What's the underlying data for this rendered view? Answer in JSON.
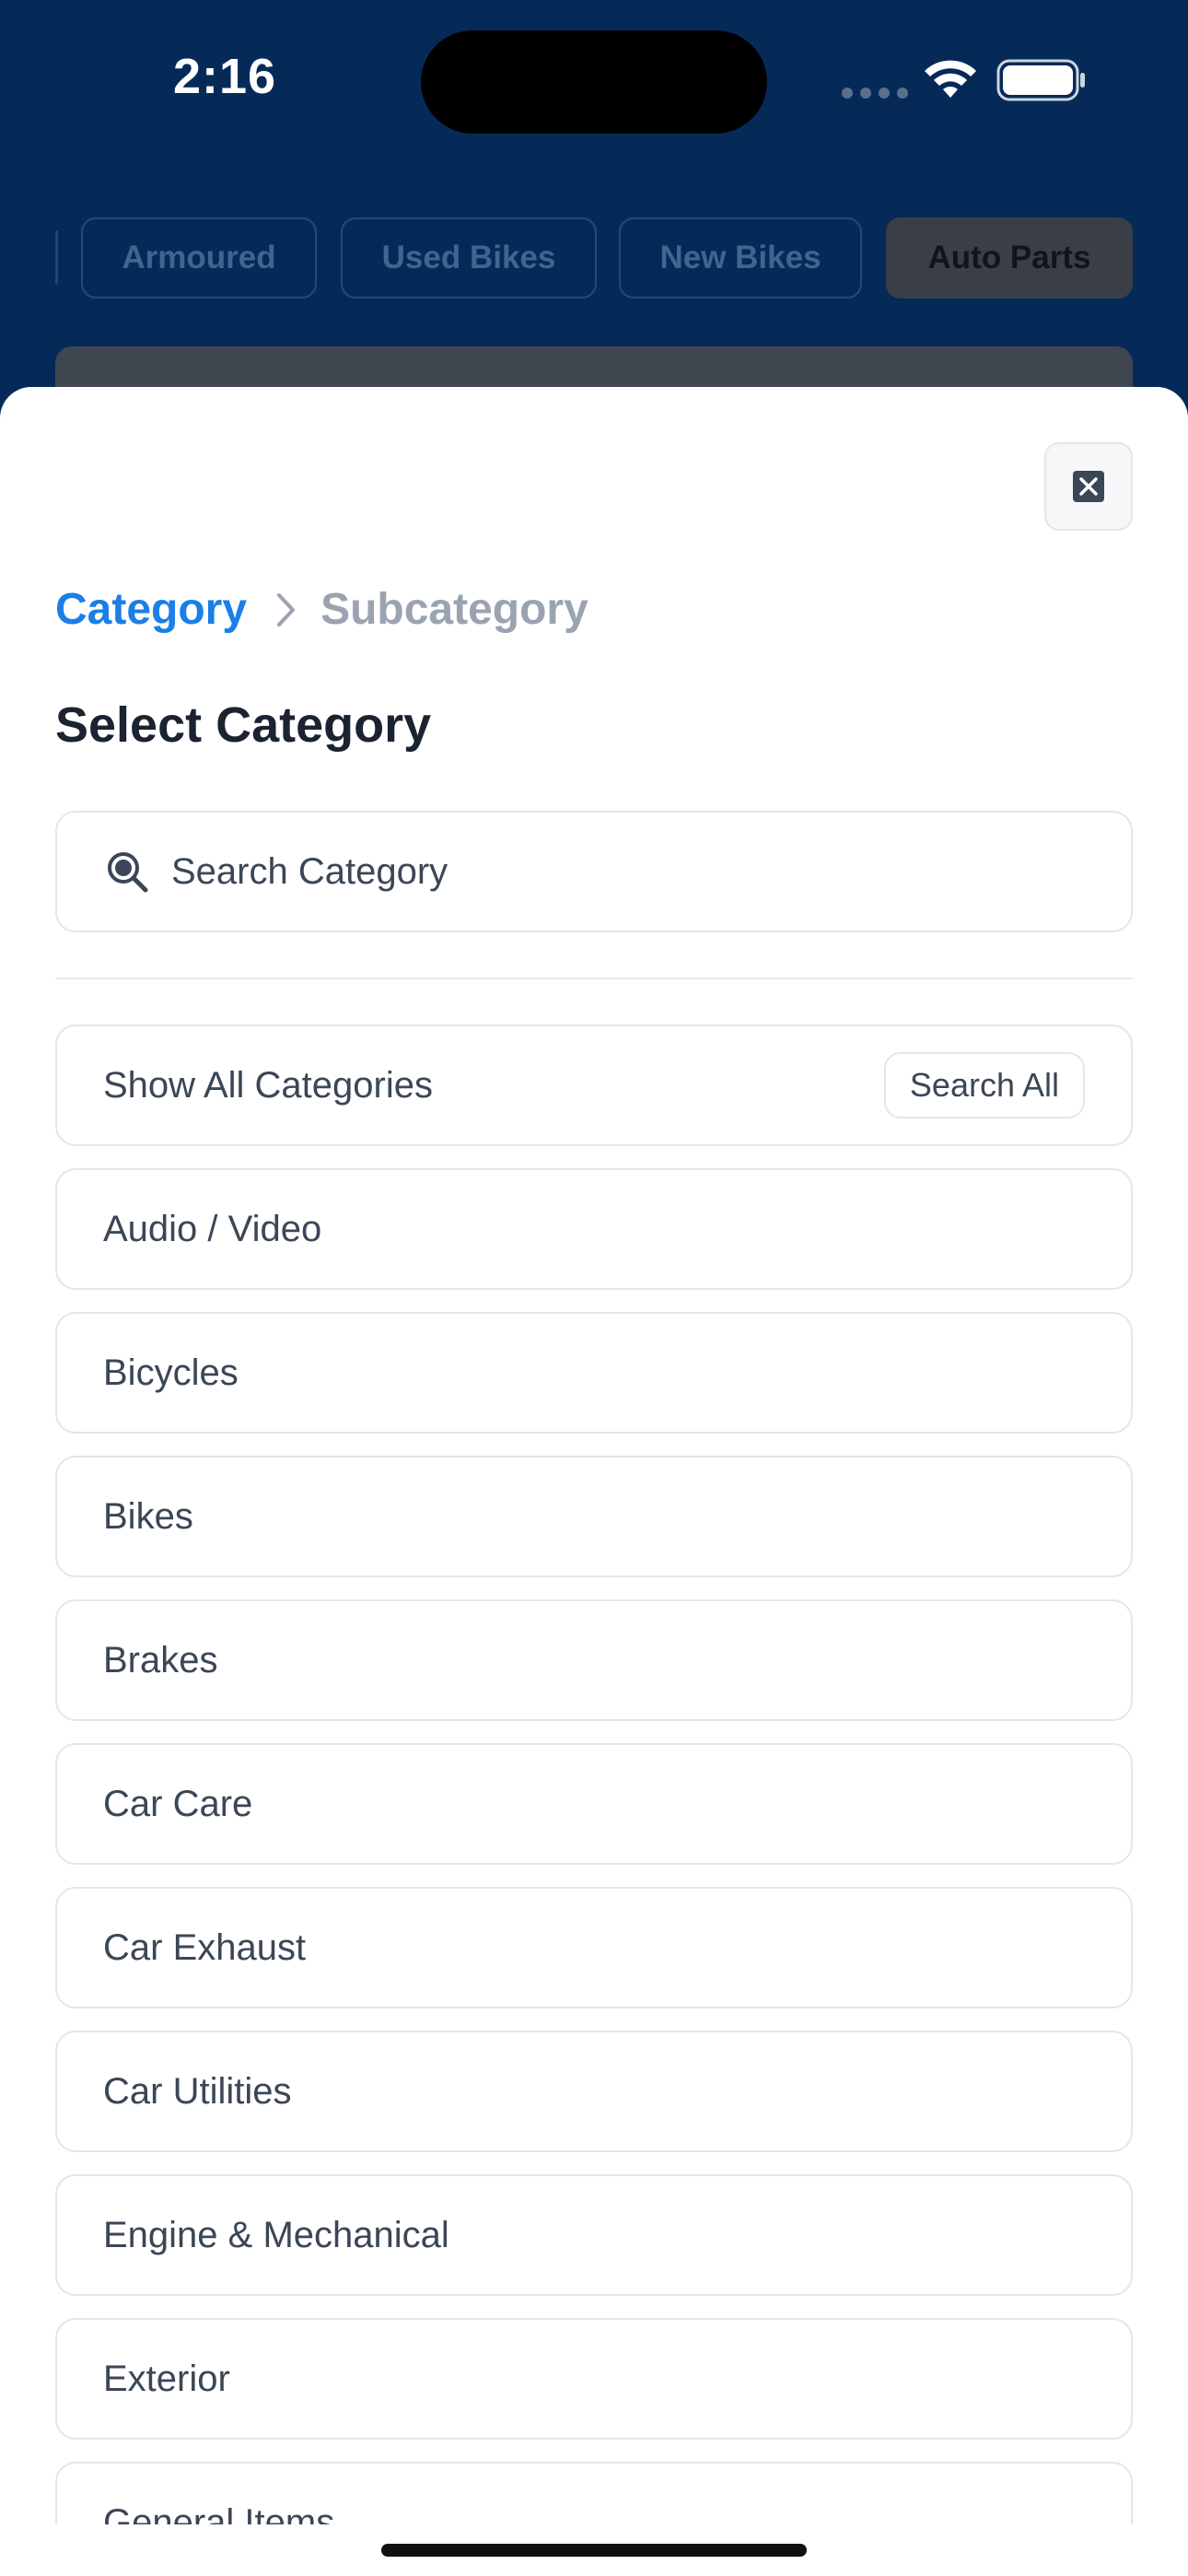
{
  "status_bar": {
    "time": "2:16"
  },
  "chips": [
    {
      "label": "Armoured",
      "active": false
    },
    {
      "label": "Used Bikes",
      "active": false
    },
    {
      "label": "New Bikes",
      "active": false
    },
    {
      "label": "Auto Parts",
      "active": true
    }
  ],
  "sheet": {
    "breadcrumb": {
      "current": "Category",
      "next": "Subcategory"
    },
    "title": "Select Category",
    "search": {
      "placeholder": "Search Category"
    },
    "show_all": {
      "label": "Show All Categories",
      "button": "Search All"
    },
    "categories": [
      "Audio / Video",
      "Bicycles",
      "Bikes",
      "Brakes",
      "Car Care",
      "Car Exhaust",
      "Car Utilities",
      "Engine & Mechanical",
      "Exterior",
      "General Items"
    ]
  },
  "colors": {
    "header_bg": "#062a58",
    "accent": "#1a7fe6",
    "text": "#3b4656",
    "muted": "#9aa3b0"
  }
}
